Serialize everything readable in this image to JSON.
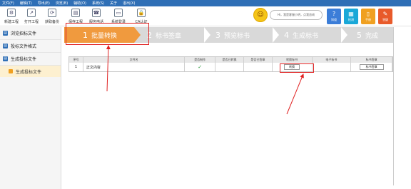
{
  "menu": [
    "文件(F)",
    "编辑(T)",
    "导出(E)",
    "浏览(B)",
    "辅助(O)",
    "系统(S)",
    "关于",
    "退出(X)"
  ],
  "toolbar": {
    "items": [
      {
        "label": "新建工程",
        "icon": "new-project-icon",
        "glyph": "⚙"
      },
      {
        "label": "打开工程",
        "icon": "open-project-icon",
        "glyph": "↗"
      },
      {
        "label": "获取备份",
        "icon": "backup-icon",
        "glyph": "⟳"
      },
      {
        "label": "保存工程",
        "icon": "save-icon",
        "glyph": "▤"
      },
      {
        "label": "服务电话",
        "icon": "service-phone-icon",
        "glyph": "☎"
      },
      {
        "label": "系统登录",
        "icon": "login-icon",
        "glyph": "▭"
      },
      {
        "label": "CA认证",
        "icon": "ca-lock-icon",
        "glyph": "🔒"
      }
    ],
    "assistant_text": "Hi，我是客服小明，点我咨询",
    "right_buttons": [
      {
        "label": "知道",
        "icon": "knowledge-icon",
        "glyph": "?",
        "color": "#3b7dd8"
      },
      {
        "label": "检测",
        "icon": "check-icon",
        "glyph": "▦",
        "color": "#1aa8d8"
      },
      {
        "label": "手册",
        "icon": "manual-icon",
        "glyph": "▯",
        "color": "#f0a020"
      },
      {
        "label": "答疑",
        "icon": "qa-icon",
        "glyph": "✎",
        "color": "#e85a2a"
      }
    ]
  },
  "sidebar": {
    "items": [
      {
        "label": "浏览招标文件"
      },
      {
        "label": "投标文件格式"
      },
      {
        "label": "生成投标文件"
      }
    ],
    "sub_item": "生成投标文件"
  },
  "steps": [
    {
      "num": "1",
      "label": "批量转换"
    },
    {
      "num": "2",
      "label": "标书签章"
    },
    {
      "num": "3",
      "label": "预览标书"
    },
    {
      "num": "4",
      "label": "生成标书"
    },
    {
      "num": "5",
      "label": "完成"
    }
  ],
  "table": {
    "headers": [
      "序号",
      "文件名",
      "是否制作",
      "是否已转换",
      "是否已签章",
      "转换标书",
      "电子标书",
      "标书签章"
    ],
    "rows": [
      {
        "index": "1",
        "filename": "正文内容",
        "made": "✓",
        "converted": "",
        "signed": "",
        "convert_btn": "转换",
        "ebid": "",
        "sign_btn": "标书签章"
      }
    ]
  },
  "colors": {
    "accent": "#2f6fb6",
    "active_step": "#f09a3e",
    "highlight": "#e02020"
  }
}
